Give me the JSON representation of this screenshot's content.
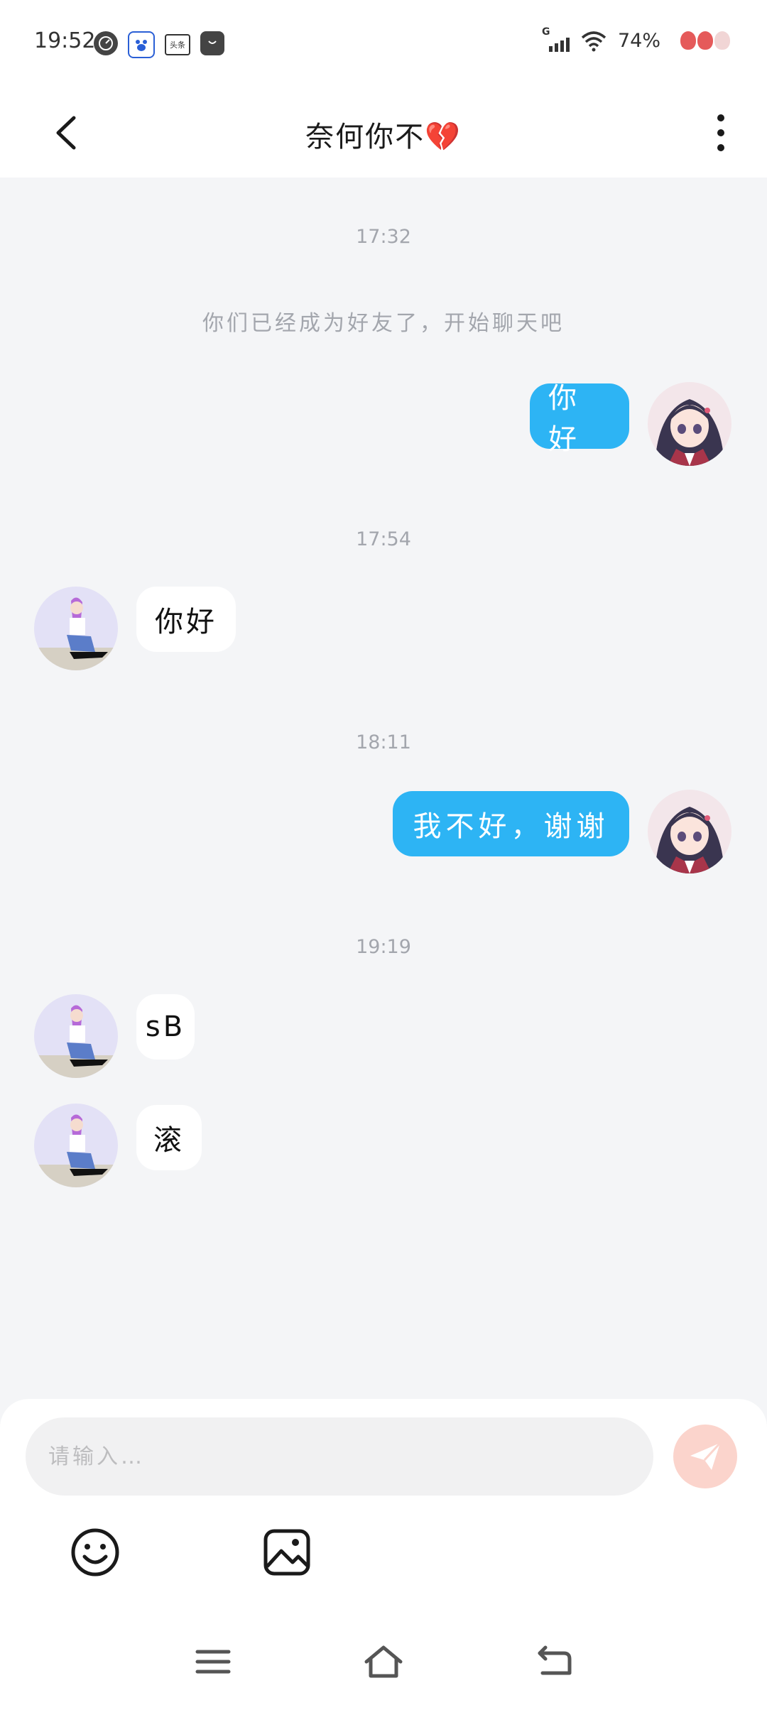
{
  "status_bar": {
    "time": "19:52",
    "network": "G",
    "battery": "74%",
    "app_icons": [
      "speed-icon",
      "baidu-icon",
      "toutiao-icon",
      "shop-bag-icon"
    ],
    "toutiao_text": "头条"
  },
  "header": {
    "title": "奈何你不",
    "title_emoji": "💔"
  },
  "chat": {
    "timestamps": [
      "17:32",
      "17:54",
      "18:11",
      "19:19"
    ],
    "system_message": "你们已经成为好友了，开始聊天吧",
    "messages": [
      {
        "sender": "me",
        "text": "你好"
      },
      {
        "sender": "them",
        "text": "你好"
      },
      {
        "sender": "me",
        "text": "我不好，谢谢"
      },
      {
        "sender": "them",
        "text": "sB"
      },
      {
        "sender": "them",
        "text": "滚"
      }
    ]
  },
  "composer": {
    "placeholder": "请输入…",
    "value": ""
  },
  "colors": {
    "my_bubble": "#2db4f4",
    "their_bubble": "#ffffff",
    "send_button": "#fbd4cc",
    "background": "#f4f5f7"
  }
}
